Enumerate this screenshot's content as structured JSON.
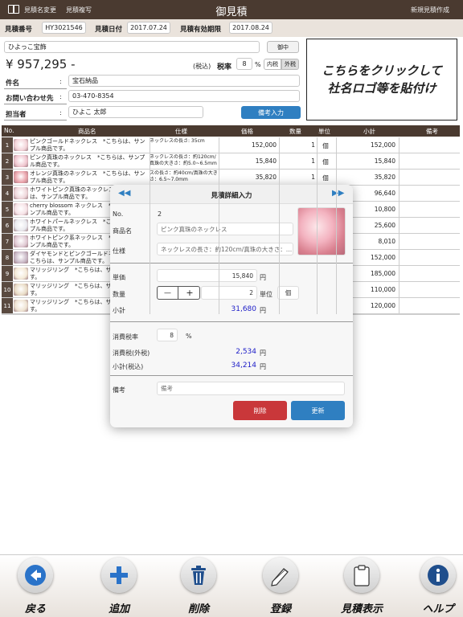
{
  "topbar": {
    "menu1": "見積名変更",
    "menu2": "見積複写",
    "title": "御見積",
    "new_quote": "新規見積作成"
  },
  "header": {
    "quote_no_label": "見積番号",
    "quote_no": "HY3021546",
    "quote_date_label": "見積日付",
    "quote_date": "2017.07.24",
    "valid_label": "見積有効期限",
    "valid_date": "2017.08.24"
  },
  "customer": {
    "name": "ひよっこ宝飾",
    "honorific": "御中",
    "total": "¥ 957,295 -",
    "tax_incl": "(税込)",
    "tax_rate_label": "税率",
    "tax_rate": "8",
    "percent": "%",
    "tax_inner": "内税",
    "tax_outer": "外税",
    "subject_label": "件名",
    "subject": "宝石納品",
    "contact_label": "お問い合わせ先",
    "contact": "03-470-8354",
    "person_label": "担当者",
    "person": "ひよこ 太郎",
    "note_button": "備考入力",
    "colon": ":"
  },
  "logo": {
    "line1": "こちらをクリックして",
    "line2": "社名ロゴ等を貼付け"
  },
  "table": {
    "headers": {
      "no": "No.",
      "name": "商品名",
      "spec": "仕様",
      "price": "価格",
      "qty": "数量",
      "unit": "単位",
      "subtotal": "小計",
      "note": "備考"
    },
    "rows": [
      {
        "no": "1",
        "name": "ピンクゴールドネックレス　*こちらは、サンプル商品です。",
        "spec": "ネックレスの長さ: 35cm",
        "price": "152,000",
        "qty": "1",
        "unit": "個",
        "subtotal": "152,000"
      },
      {
        "no": "2",
        "name": "ピンク真珠のネックレス　*こちらは、サンプル商品です。",
        "spec": "ネックレスの長さ：約120cm/真珠の大きさ：約5.0~6.5mm",
        "price": "15,840",
        "qty": "1",
        "unit": "個",
        "subtotal": "15,840"
      },
      {
        "no": "3",
        "name": "オレンジ真珠のネックレス　*こちらは、サンプル商品です。",
        "spec": "スの長さ：約40cm/真珠の大きさ：6.5~7.0mm",
        "price": "35,820",
        "qty": "1",
        "unit": "個",
        "subtotal": "35,820"
      },
      {
        "no": "4",
        "name": "ホワイトピンク真珠のネックレス　*こちらは、サンプル商品です。",
        "spec": "",
        "price": "",
        "qty": "",
        "unit": "",
        "subtotal": "96,640"
      },
      {
        "no": "5",
        "name": "cherry blossom ネックレス　*こちらは、サンプル商品です。",
        "spec": "",
        "price": "",
        "qty": "",
        "unit": "",
        "subtotal": "10,800"
      },
      {
        "no": "6",
        "name": "ホワイトパールネックレス　*こちらは、サンプル商品です。",
        "spec": "",
        "price": "",
        "qty": "",
        "unit": "",
        "subtotal": "25,600"
      },
      {
        "no": "7",
        "name": "ホワイトピンク系ネックレス　*こちらは、サンプル商品です。",
        "spec": "",
        "price": "",
        "qty": "",
        "unit": "",
        "subtotal": "8,010"
      },
      {
        "no": "8",
        "name": "ダイヤモンドとピンクゴールドネックレス　*こちらは、サンプル商品です。",
        "spec": "",
        "price": "",
        "qty": "",
        "unit": "",
        "subtotal": "152,000"
      },
      {
        "no": "9",
        "name": "マリッジリング　*こちらは、サンプル商品です。",
        "spec": "",
        "price": "",
        "qty": "",
        "unit": "",
        "subtotal": "185,000"
      },
      {
        "no": "10",
        "name": "マリッジリング　*こちらは、サンプル商品です。",
        "spec": "",
        "price": "",
        "qty": "",
        "unit": "",
        "subtotal": "110,000"
      },
      {
        "no": "11",
        "name": "マリッジリング　*こちらは、サンプル商品です。",
        "spec": "",
        "price": "",
        "qty": "",
        "unit": "",
        "subtotal": "120,000"
      }
    ]
  },
  "modal": {
    "title": "見積詳細入力",
    "prev": "◀◀",
    "next": "▶▶",
    "no_label": "No.",
    "no": "2",
    "name_label": "商品名",
    "name": "ピンク真珠のネックレス",
    "spec_label": "仕様",
    "spec": "ネックレスの長さ：約120cm/真珠の大きさ：…",
    "price_label": "単価",
    "price": "15,840",
    "yen": "円",
    "qty_label": "数量",
    "minus": "—",
    "plus": "+",
    "qty": "2",
    "unit_label": "単位",
    "unit": "個",
    "subtotal_label": "小計",
    "subtotal": "31,680",
    "taxrate_label": "消費税率",
    "taxrate": "8",
    "percent": "%",
    "tax_label": "消費税(外税)",
    "tax": "2,534",
    "total_label": "小計(税込)",
    "total": "34,214",
    "note_label": "備考",
    "note_placeholder": "備考",
    "delete": "削除",
    "update": "更新"
  },
  "toolbar": {
    "back": "戻る",
    "add": "追加",
    "delete": "削除",
    "register": "登録",
    "view": "見積表示",
    "help": "ヘルプ"
  },
  "colors": {
    "header_brown": "#4a3a30",
    "blue_button": "#2f7fc1",
    "red_button": "#c9373a",
    "blue_text": "#2020c8"
  }
}
